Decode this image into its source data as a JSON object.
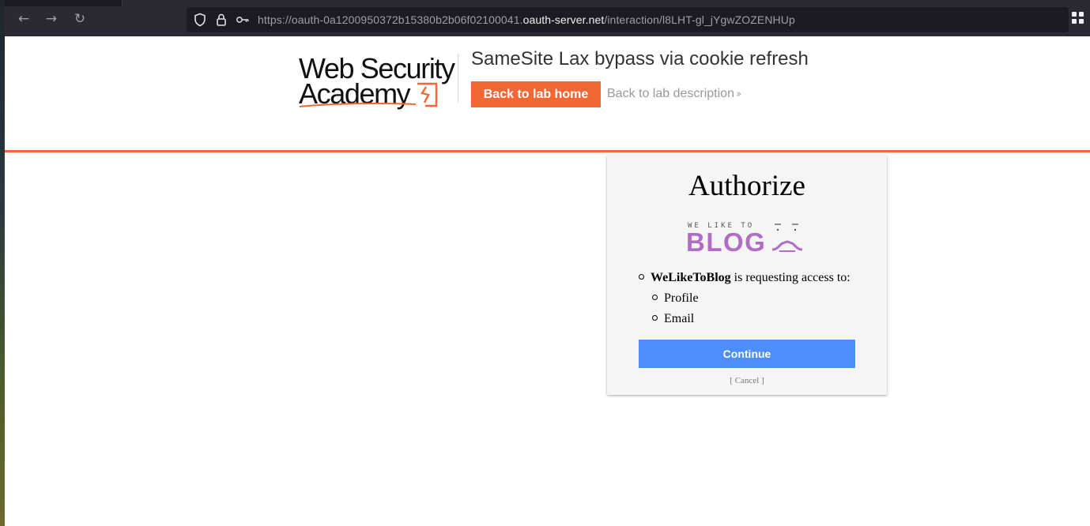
{
  "browser": {
    "url_prefix": "https://oauth-0a1200950372b15380b2b06f02100041.",
    "url_host": "oauth-server.net",
    "url_path": "/interaction/l8LHT-gl_jYgwZOZENHUp",
    "icons": [
      "back-icon",
      "forward-icon",
      "reload-icon",
      "shield-icon",
      "lock-icon",
      "key-icon",
      "grid-icon"
    ]
  },
  "lab": {
    "logo_line1": "Web Security",
    "logo_line2": "Academy",
    "title": "SameSite Lax bypass via cookie refresh",
    "back_home": "Back to lab home",
    "back_description": "Back to lab description",
    "accent_color": "#f36735"
  },
  "authorize": {
    "heading": "Authorize",
    "logo_small": "WE LIKE TO",
    "logo_big": "BLOG",
    "client_name": "WeLikeToBlog",
    "request_text": " is requesting access to:",
    "scopes": [
      "Profile",
      "Email"
    ],
    "continue_label": "Continue",
    "cancel_label": "[ Cancel ]",
    "continue_color": "#4c8efc",
    "logo_color": "#b06dc5"
  }
}
